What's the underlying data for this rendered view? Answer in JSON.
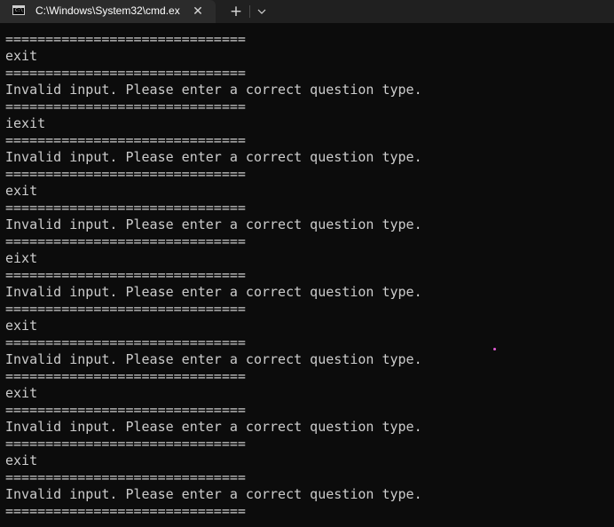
{
  "tab": {
    "title": "C:\\Windows\\System32\\cmd.ex",
    "icon": "cmd-prompt-icon",
    "icon_text": "C:\\",
    "close_glyph": "✕",
    "newtab_glyph": "+",
    "dropdown_icon": "chevron-down-icon"
  },
  "console": {
    "lines": [
      "==============================",
      "exit",
      "==============================",
      "Invalid input. Please enter a correct question type.",
      "==============================",
      "iexit",
      "==============================",
      "Invalid input. Please enter a correct question type.",
      "==============================",
      "exit",
      "==============================",
      "Invalid input. Please enter a correct question type.",
      "==============================",
      "eixt",
      "==============================",
      "Invalid input. Please enter a correct question type.",
      "==============================",
      "exit",
      "==============================",
      "Invalid input. Please enter a correct question type.",
      "==============================",
      "exit",
      "==============================",
      "Invalid input. Please enter a correct question type.",
      "==============================",
      "exit",
      "==============================",
      "Invalid input. Please enter a correct question type.",
      "=============================="
    ]
  },
  "colors": {
    "console_background": "#0c0c0c",
    "console_text": "#cccccc",
    "tabstrip_background": "#202020",
    "active_tab_background": "#2b2b2b"
  }
}
